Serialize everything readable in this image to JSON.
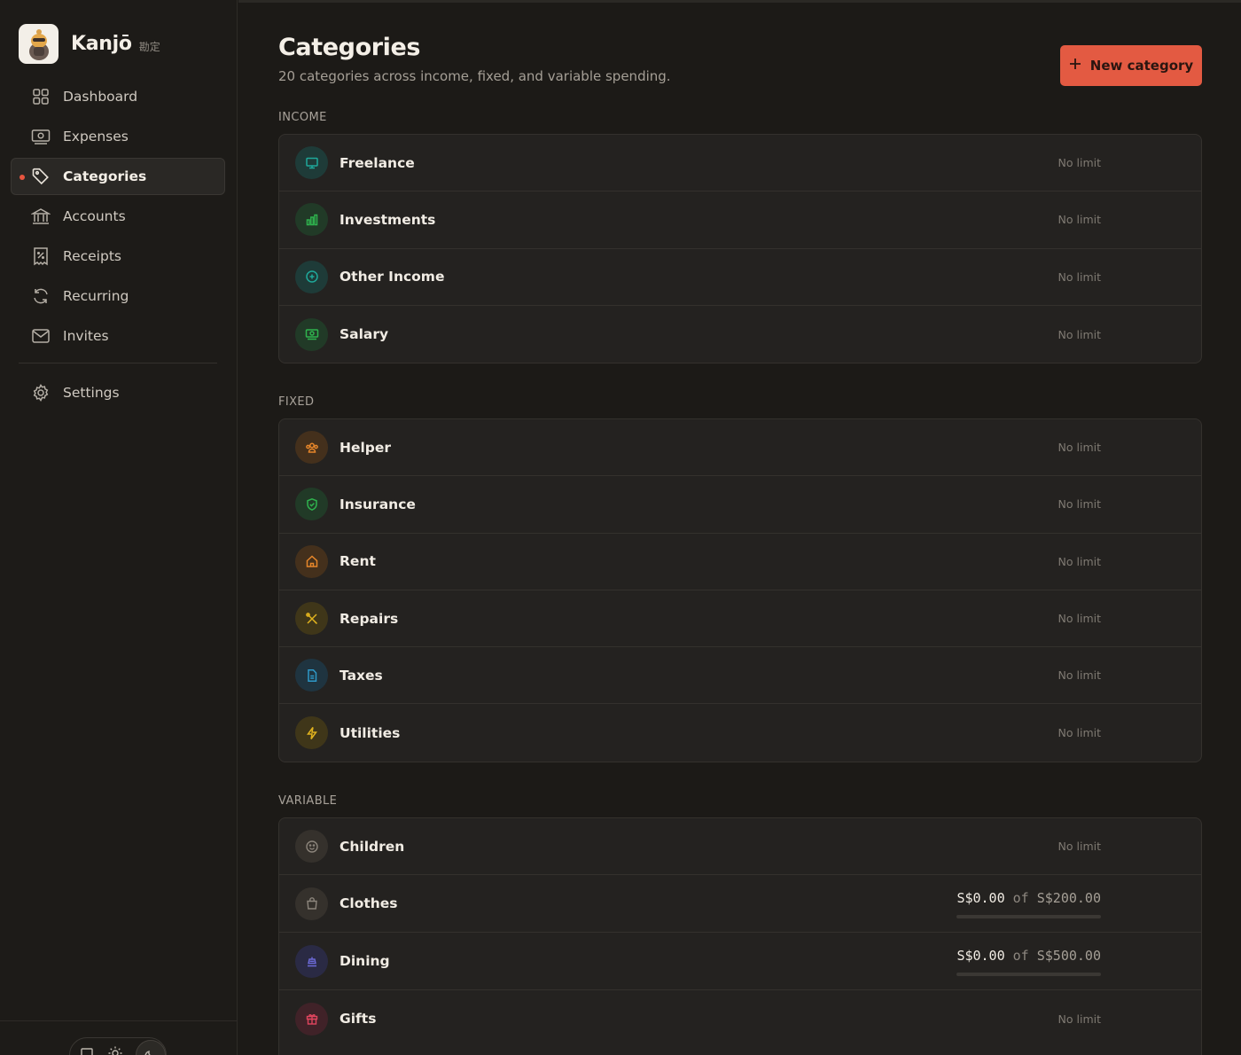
{
  "brand": {
    "name": "Kanjō",
    "subtitle": "勘定"
  },
  "nav": {
    "items": [
      {
        "label": "Dashboard",
        "icon": "grid-icon"
      },
      {
        "label": "Expenses",
        "icon": "banknote-icon"
      },
      {
        "label": "Categories",
        "icon": "tag-icon",
        "active": true
      },
      {
        "label": "Accounts",
        "icon": "bank-icon"
      },
      {
        "label": "Receipts",
        "icon": "receipt-icon"
      },
      {
        "label": "Recurring",
        "icon": "refresh-icon"
      },
      {
        "label": "Invites",
        "icon": "mail-icon"
      }
    ],
    "settings": {
      "label": "Settings",
      "icon": "gear-icon"
    }
  },
  "header": {
    "title": "Categories",
    "subtitle": "20 categories across income, fixed, and variable spending.",
    "new_button": "New category"
  },
  "sections": {
    "income": {
      "label": "INCOME",
      "items": [
        {
          "name": "Freelance",
          "limit": "No limit",
          "icon": "monitor-icon",
          "color": "#1fa89a",
          "bg": "#1e3b38"
        },
        {
          "name": "Investments",
          "limit": "No limit",
          "icon": "bar-chart-icon",
          "color": "#2fb34e",
          "bg": "#213a27"
        },
        {
          "name": "Other Income",
          "limit": "No limit",
          "icon": "plus-circle-icon",
          "color": "#1fa89a",
          "bg": "#1e3b38"
        },
        {
          "name": "Salary",
          "limit": "No limit",
          "icon": "banknote-icon",
          "color": "#2fb34e",
          "bg": "#213a27"
        }
      ]
    },
    "fixed": {
      "label": "FIXED",
      "items": [
        {
          "name": "Helper",
          "limit": "No limit",
          "icon": "users-icon",
          "color": "#e6862a",
          "bg": "#44301c"
        },
        {
          "name": "Insurance",
          "limit": "No limit",
          "icon": "shield-icon",
          "color": "#2fb34e",
          "bg": "#213a27"
        },
        {
          "name": "Rent",
          "limit": "No limit",
          "icon": "home-icon",
          "color": "#e6862a",
          "bg": "#44301c"
        },
        {
          "name": "Repairs",
          "limit": "No limit",
          "icon": "tools-icon",
          "color": "#e0b21e",
          "bg": "#3f3619"
        },
        {
          "name": "Taxes",
          "limit": "No limit",
          "icon": "file-icon",
          "color": "#2e98c8",
          "bg": "#1f3440"
        },
        {
          "name": "Utilities",
          "limit": "No limit",
          "icon": "bolt-icon",
          "color": "#e0b21e",
          "bg": "#3f3619"
        }
      ]
    },
    "variable": {
      "label": "VARIABLE",
      "items": [
        {
          "name": "Children",
          "limit": "No limit",
          "icon": "smile-icon",
          "color": "#8c857c",
          "bg": "#35312c"
        },
        {
          "name": "Clothes",
          "spent": "S$0.00",
          "of": "of",
          "total": "S$200.00",
          "progress": 0,
          "icon": "bag-icon",
          "color": "#8c857c",
          "bg": "#35312c"
        },
        {
          "name": "Dining",
          "spent": "S$0.00",
          "of": "of",
          "total": "S$500.00",
          "progress": 0,
          "icon": "food-icon",
          "color": "#6c6ad8",
          "bg": "#2a2a44"
        },
        {
          "name": "Gifts",
          "limit": "No limit",
          "icon": "gift-icon",
          "color": "#e0455e",
          "bg": "#402228"
        }
      ]
    }
  }
}
